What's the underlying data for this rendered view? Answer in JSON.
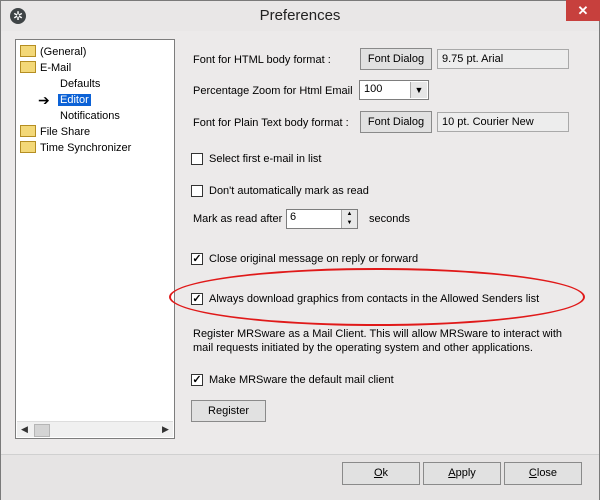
{
  "window": {
    "title": "Preferences",
    "close_glyph": "✕"
  },
  "tree": {
    "items": [
      {
        "label": "(General)"
      },
      {
        "label": "E-Mail"
      },
      {
        "label": "Defaults"
      },
      {
        "label": "Editor"
      },
      {
        "label": "Notifications"
      },
      {
        "label": "File Share"
      },
      {
        "label": "Time Synchronizer"
      }
    ]
  },
  "html_font": {
    "label": "Font for HTML body format :",
    "button": "Font Dialog",
    "value": "9.75 pt. Arial"
  },
  "zoom": {
    "label": "Percentage Zoom for Html Email",
    "value": "100"
  },
  "plain_font": {
    "label": "Font for Plain Text body format :",
    "button": "Font Dialog",
    "value": "10 pt. Courier New"
  },
  "options": {
    "select_first": {
      "label": "Select first e-mail in list",
      "checked": false
    },
    "dont_mark": {
      "label": "Don't automatically mark as read",
      "checked": false
    },
    "mark_after_label": "Mark as read after",
    "mark_after_value": "6",
    "seconds_label": "seconds",
    "close_original": {
      "label": "Close original message on reply or forward",
      "checked": true
    },
    "always_download": {
      "label": "Always download graphics from contacts in the Allowed Senders list",
      "checked": true
    }
  },
  "register": {
    "description_line1": "Register MRSware as a Mail Client.  This will allow MRSware to interact with",
    "description_line2": "mail requests initiated by the operating system and other applications.",
    "default_client": {
      "label": "Make MRSware the default mail client",
      "checked": true
    },
    "button": "Register"
  },
  "footer": {
    "ok_first": "O",
    "ok_rest": "k",
    "apply_first": "A",
    "apply_rest": "pply",
    "close_first": "C",
    "close_rest": "lose"
  }
}
